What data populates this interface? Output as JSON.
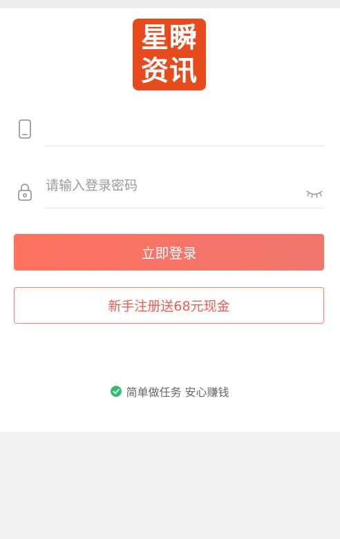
{
  "logo": {
    "line1": "星瞬",
    "line2": "资讯",
    "color": "#e64a1d"
  },
  "form": {
    "phone": {
      "icon": "phone-icon",
      "value": "",
      "placeholder": ""
    },
    "password": {
      "icon": "lock-icon",
      "placeholder": "请输入登录密码",
      "toggle_icon": "eye-closed-icon"
    }
  },
  "buttons": {
    "login_label": "立即登录",
    "register_label": "新手注册送68元现金"
  },
  "footer": {
    "icon": "check-circle-icon",
    "slogan": "简单做任务 安心赚钱"
  },
  "colors": {
    "accent": "#f5705f",
    "register_text": "#ef5d50",
    "check": "#2fbf71"
  }
}
